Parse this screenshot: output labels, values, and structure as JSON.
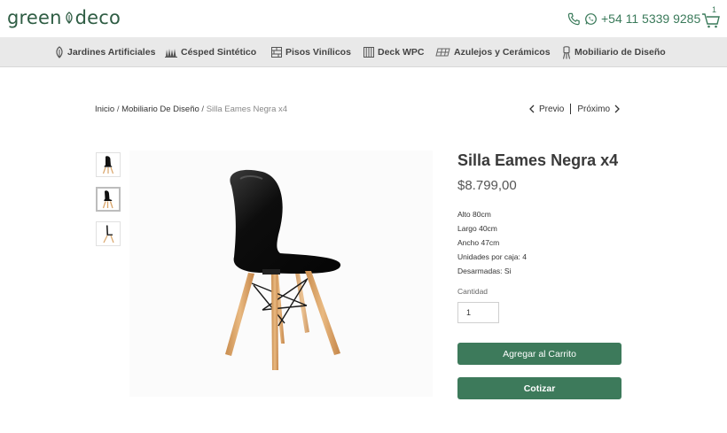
{
  "header": {
    "logo_left": "green",
    "logo_right": "deco",
    "phone": "+54 11 5339 9285",
    "cart_count": "1"
  },
  "nav": {
    "items": [
      {
        "label": "Jardines Artificiales",
        "icon": "leaf-icon"
      },
      {
        "label": "Césped Sintético",
        "icon": "grass-icon"
      },
      {
        "label": "Pisos Vinílicos",
        "icon": "floor-icon"
      },
      {
        "label": "Deck WPC",
        "icon": "deck-icon"
      },
      {
        "label": "Azulejos y Cerámicos",
        "icon": "tiles-icon"
      },
      {
        "label": "Mobiliario de Diseño",
        "icon": "chair-icon"
      }
    ]
  },
  "breadcrumb": {
    "home": "Inicio",
    "sep": " / ",
    "category": "Mobiliario De Diseño",
    "current": "Silla Eames Negra x4"
  },
  "pager": {
    "prev": "Previo",
    "next": "Próximo"
  },
  "product": {
    "title": "Silla Eames Negra x4",
    "price": "$8.799,00",
    "specs": [
      "Alto 80cm",
      "Largo 40cm",
      "Ancho 47cm",
      "Unidades por caja: 4",
      "Desarmadas: Si"
    ],
    "quantity_label": "Cantidad",
    "quantity_value": "1",
    "add_to_cart": "Agregar al Carrito",
    "quote": "Cotizar"
  },
  "colors": {
    "brand_green": "#3d7a5b",
    "logo_green": "#2f5d44",
    "nav_bg": "#e9e9e9",
    "chair_shell": "#111111",
    "chair_wood": "#d9a56a"
  }
}
